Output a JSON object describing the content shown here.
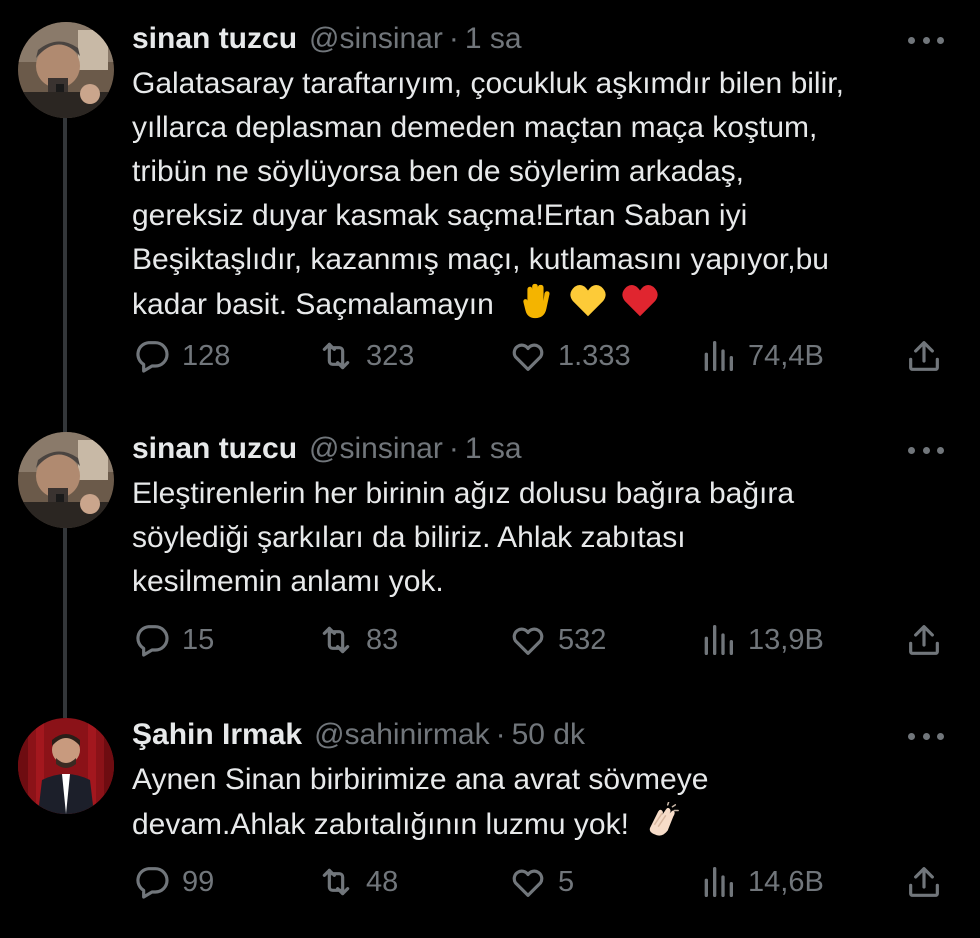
{
  "tweets": [
    {
      "display_name": "sinan tuzcu",
      "handle": "@sinsinar",
      "separator": "·",
      "time": "1 sa",
      "text_lines": [
        "Galatasaray taraftarıyım, çocukluk aşkımdır bilen bilir,",
        "yıllarca deplasman demeden maçtan maça koştum,",
        "tribün ne söylüyorsa ben de söylerim arkadaş,",
        "gereksiz duyar kasmak saçma!Ertan Saban iyi",
        "Beşiktaşlıdır, kazanmış maçı, kutlamasını yapıyor,bu",
        "kadar basit. Saçmalamayın"
      ],
      "emojis": [
        "raised-hand-emoji",
        "yellow-heart-emoji",
        "red-heart-emoji"
      ],
      "replies": "128",
      "retweets": "323",
      "likes": "1.333",
      "views": "74,4B"
    },
    {
      "display_name": "sinan tuzcu",
      "handle": "@sinsinar",
      "separator": "·",
      "time": "1 sa",
      "text_lines": [
        "Eleştirenlerin her birinin ağız dolusu bağıra bağıra",
        "söylediği şarkıları da biliriz. Ahlak zabıtası",
        "kesilmemin anlamı yok."
      ],
      "replies": "15",
      "retweets": "83",
      "likes": "532",
      "views": "13,9B"
    },
    {
      "display_name": "Şahin Irmak",
      "handle": "@sahinirmak",
      "separator": "·",
      "time": "50 dk",
      "text_lines": [
        "Aynen Sinan birbirimize ana avrat sövmeye",
        "devam.Ahlak zabıtalığının luzmu yok!"
      ],
      "emojis": [
        "clapping-hands-emoji"
      ],
      "replies": "99",
      "retweets": "48",
      "likes": "5",
      "views": "14,6B"
    }
  ],
  "colors": {
    "background": "#000000",
    "primary_text": "#e7e9ea",
    "secondary_text": "#71767b",
    "thread_line": "#333639"
  }
}
